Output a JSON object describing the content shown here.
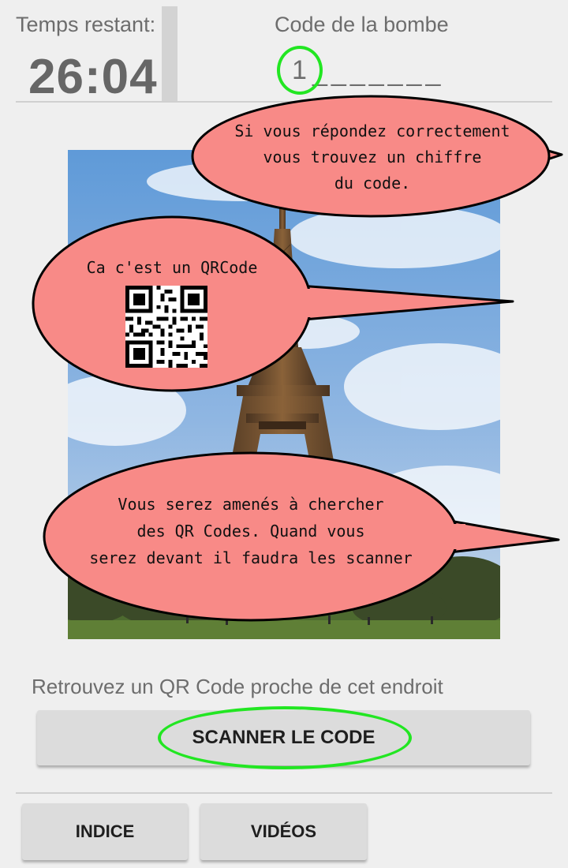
{
  "header": {
    "timer_label": "Temps restant:",
    "timer_value": "26:04",
    "code_label": "Code de la bombe",
    "code_digit": "1",
    "code_placeholder": "_______"
  },
  "bubbles": {
    "top": "Si vous répondez correctement\nvous trouvez un chiffre\ndu code.",
    "middle": "Ca c'est un QRCode",
    "bottom": "Vous serez amenés à chercher\ndes QR Codes. Quand vous\nserez devant il faudra les scanner"
  },
  "photo": {
    "subject": "eiffel-tower"
  },
  "hint_text": "Retrouvez un QR Code proche de cet endroit",
  "buttons": {
    "scan": "SCANNER LE CODE",
    "indice": "INDICE",
    "videos": "VIDÉOS"
  },
  "colors": {
    "background": "#efefef",
    "bubble_fill": "#f88a87",
    "highlight_ring": "#22e622",
    "button": "#dcdcdc",
    "muted_text": "#6d6d6d"
  }
}
